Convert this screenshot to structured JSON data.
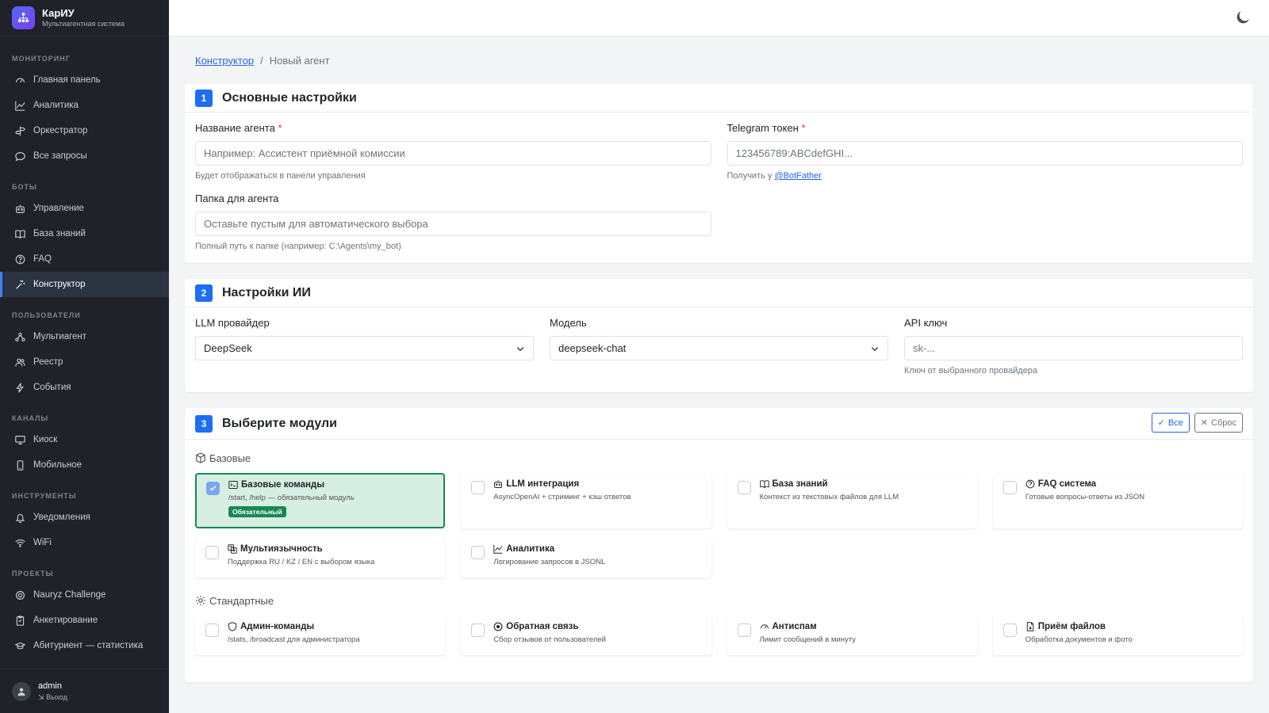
{
  "brand": {
    "title": "КарИУ",
    "subtitle": "Мультиагентная система"
  },
  "sidebar": {
    "sections": [
      {
        "label": "МОНИТОРИНГ",
        "items": [
          {
            "label": "Главная панель",
            "icon": "dashboard-icon"
          },
          {
            "label": "Аналитика",
            "icon": "chart-line-icon"
          },
          {
            "label": "Оркестратор",
            "icon": "signpost-icon"
          },
          {
            "label": "Все запросы",
            "icon": "chat-icon"
          }
        ]
      },
      {
        "label": "БОТЫ",
        "items": [
          {
            "label": "Управление",
            "icon": "robot-icon"
          },
          {
            "label": "База знаний",
            "icon": "book-icon"
          },
          {
            "label": "FAQ",
            "icon": "question-circle-icon"
          },
          {
            "label": "Конструктор",
            "icon": "magic-wand-icon",
            "active": true
          }
        ]
      },
      {
        "label": "ПОЛЬЗОВАТЕЛИ",
        "items": [
          {
            "label": "Мультиагент",
            "icon": "diagram-icon"
          },
          {
            "label": "Реестр",
            "icon": "people-icon"
          },
          {
            "label": "События",
            "icon": "lightning-icon"
          }
        ]
      },
      {
        "label": "КАНАЛЫ",
        "items": [
          {
            "label": "Киоск",
            "icon": "monitor-icon"
          },
          {
            "label": "Мобильное",
            "icon": "phone-icon"
          }
        ]
      },
      {
        "label": "ИНСТРУМЕНТЫ",
        "items": [
          {
            "label": "Уведомления",
            "icon": "bell-icon"
          },
          {
            "label": "WiFi",
            "icon": "wifi-icon"
          }
        ]
      },
      {
        "label": "ПРОЕКТЫ",
        "items": [
          {
            "label": "Nauryz Challenge",
            "icon": "gear-icon"
          },
          {
            "label": "Анкетирование",
            "icon": "clipboard-icon"
          },
          {
            "label": "Абитуриент — статистика",
            "icon": "mortarboard-icon"
          }
        ]
      }
    ],
    "user": {
      "name": "admin",
      "logout": "Выход"
    }
  },
  "breadcrumb": {
    "root": "Конструктор",
    "current": "Новый агент"
  },
  "section1": {
    "step": "1",
    "title": "Основные настройки",
    "agent_name": {
      "label": "Название агента",
      "required": "*",
      "placeholder": "Например: Ассистент приёмной комиссии",
      "hint": "Будет отображаться в панели управления"
    },
    "telegram": {
      "label": "Telegram токен",
      "required": "*",
      "placeholder": "123456789:ABCdefGHI...",
      "hint_prefix": "Получить у ",
      "hint_link": "@BotFather"
    },
    "folder": {
      "label": "Папка для агента",
      "placeholder": "Оставьте пустым для автоматического выбора",
      "hint": "Полный путь к папке (например: C:\\Agents\\my_bot)"
    }
  },
  "section2": {
    "step": "2",
    "title": "Настройки ИИ",
    "provider": {
      "label": "LLM провайдер",
      "value": "DeepSeek"
    },
    "model": {
      "label": "Модель",
      "value": "deepseek-chat"
    },
    "api_key": {
      "label": "API ключ",
      "placeholder": "sk-...",
      "hint": "Ключ от выбранного провайдера"
    }
  },
  "section3": {
    "step": "3",
    "title": "Выберите модули",
    "btn_all": "Все",
    "btn_reset": "Сброс",
    "groups": [
      {
        "label": "Базовые",
        "modules": [
          {
            "title": "Базовые команды",
            "desc": "/start, /help — обязательный модуль",
            "badge": "Обязательный",
            "selected": true,
            "icon": "terminal-icon"
          },
          {
            "title": "LLM интеграция",
            "desc": "AsyncOpenAI + стриминг + кэш ответов",
            "icon": "robot-icon"
          },
          {
            "title": "База знаний",
            "desc": "Контекст из текстовых файлов для LLM",
            "icon": "book-icon"
          },
          {
            "title": "FAQ система",
            "desc": "Готовые вопросы-ответы из JSON",
            "icon": "question-circle-icon"
          },
          {
            "title": "Мультиязычность",
            "desc": "Поддержка RU / KZ / EN с выбором языка",
            "icon": "translate-icon"
          },
          {
            "title": "Аналитика",
            "desc": "Логирование запросов в JSONL",
            "icon": "chart-line-icon"
          }
        ]
      },
      {
        "label": "Стандартные",
        "modules": [
          {
            "title": "Админ-команды",
            "desc": "/stats, /broadcast для администратора",
            "icon": "shield-icon"
          },
          {
            "title": "Обратная связь",
            "desc": "Сбор отзывов от пользователей",
            "icon": "chat-icon"
          },
          {
            "title": "Антиспам",
            "desc": "Лимит сообщений в минуту",
            "icon": "speedometer-icon"
          },
          {
            "title": "Приём файлов",
            "desc": "Обработка документов и фото",
            "icon": "file-icon"
          }
        ]
      }
    ]
  },
  "colors": {
    "sidebar_bg": "#1f2329",
    "accent": "#1d6ef5",
    "success": "#198754",
    "selected_bg": "#d6efe2"
  }
}
